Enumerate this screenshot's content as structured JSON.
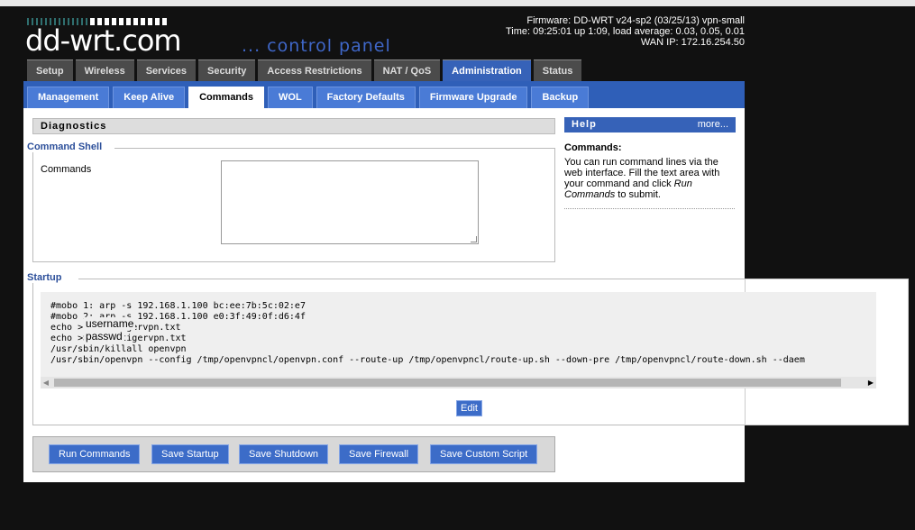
{
  "header": {
    "logo": "dd-wrt.com",
    "subtitle": "... control panel",
    "firmware": "Firmware: DD-WRT v24-sp2 (03/25/13) vpn-small",
    "time": "Time: 09:25:01 up 1:09, load average: 0.03, 0.05, 0.01",
    "wan_ip": "WAN IP: 172.16.254.50"
  },
  "main_tabs": [
    "Setup",
    "Wireless",
    "Services",
    "Security",
    "Access Restrictions",
    "NAT / QoS",
    "Administration",
    "Status"
  ],
  "main_tab_active": "Administration",
  "sub_tabs": [
    "Management",
    "Keep Alive",
    "Commands",
    "WOL",
    "Factory Defaults",
    "Firmware Upgrade",
    "Backup"
  ],
  "sub_tab_active": "Commands",
  "diagnostics": {
    "title": "Diagnostics",
    "shell_legend": "Command Shell",
    "commands_label": "Commands",
    "commands_value": ""
  },
  "help": {
    "title": "Help",
    "more": "more...",
    "heading": "Commands:",
    "text_1": "You can run command lines via the web interface. Fill the text area with your command and click ",
    "text_em": "Run Commands",
    "text_2": " to submit."
  },
  "startup": {
    "legend": "Startup",
    "lines": [
      "#mobo 1: arp -s 192.168.1.100 bc:ee:7b:5c:02:e7",
      "#mobo 2: arp -s 192.168.1.100 e0:3f:49:0f:d6:4f",
      "echo            > /tmp/tigervpn.txt",
      "echo            >> /tmp/tigervpn.txt",
      "/usr/sbin/killall openvpn",
      "/usr/sbin/openvpn --config /tmp/openvpncl/openvpn.conf --route-up /tmp/openvpncl/route-up.sh --down-pre /tmp/openvpncl/route-down.sh --daem"
    ],
    "username_overlay": "username",
    "passwd_overlay": "passwd",
    "edit_label": "Edit"
  },
  "buttons": [
    "Run Commands",
    "Save Startup",
    "Save Shutdown",
    "Save Firewall",
    "Save Custom Script"
  ]
}
